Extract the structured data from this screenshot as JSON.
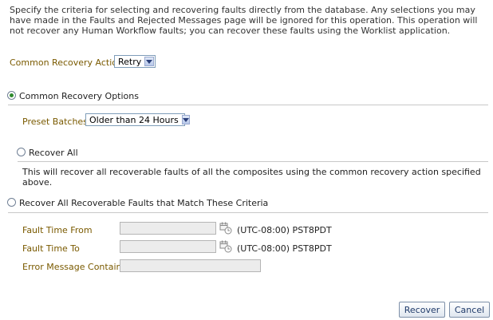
{
  "intro": "Specify the criteria for selecting and recovering faults directly from the database. Any selections you may have made in the Faults and Rejected Messages page will be ignored for this operation. This operation will not recover any Human Workflow faults; you can recover these faults using the Worklist application.",
  "common_recovery_action": {
    "label": "Common Recovery Action",
    "value": "Retry"
  },
  "common_recovery_options": {
    "label": "Common Recovery Options",
    "selected": true,
    "preset_batches": {
      "label": "Preset Batches",
      "value": "Older than 24 Hours"
    }
  },
  "recover_all": {
    "label": "Recover All",
    "selected": false,
    "description": "This will recover all recoverable faults of all the composites using the common recovery action specified above."
  },
  "recover_criteria": {
    "label": "Recover All Recoverable Faults that Match These Criteria",
    "selected": false,
    "fault_time_from": {
      "label": "Fault Time From",
      "value": "",
      "timezone": "(UTC-08:00) PST8PDT"
    },
    "fault_time_to": {
      "label": "Fault Time To",
      "value": "",
      "timezone": "(UTC-08:00) PST8PDT"
    },
    "error_message": {
      "label": "Error Message Contains",
      "value": ""
    }
  },
  "buttons": {
    "recover": "Recover",
    "cancel": "Cancel"
  },
  "colors": {
    "label_brown": "#7a5a00",
    "radio_selected": "#2f8a2f",
    "divider": "#c8c8c8"
  }
}
